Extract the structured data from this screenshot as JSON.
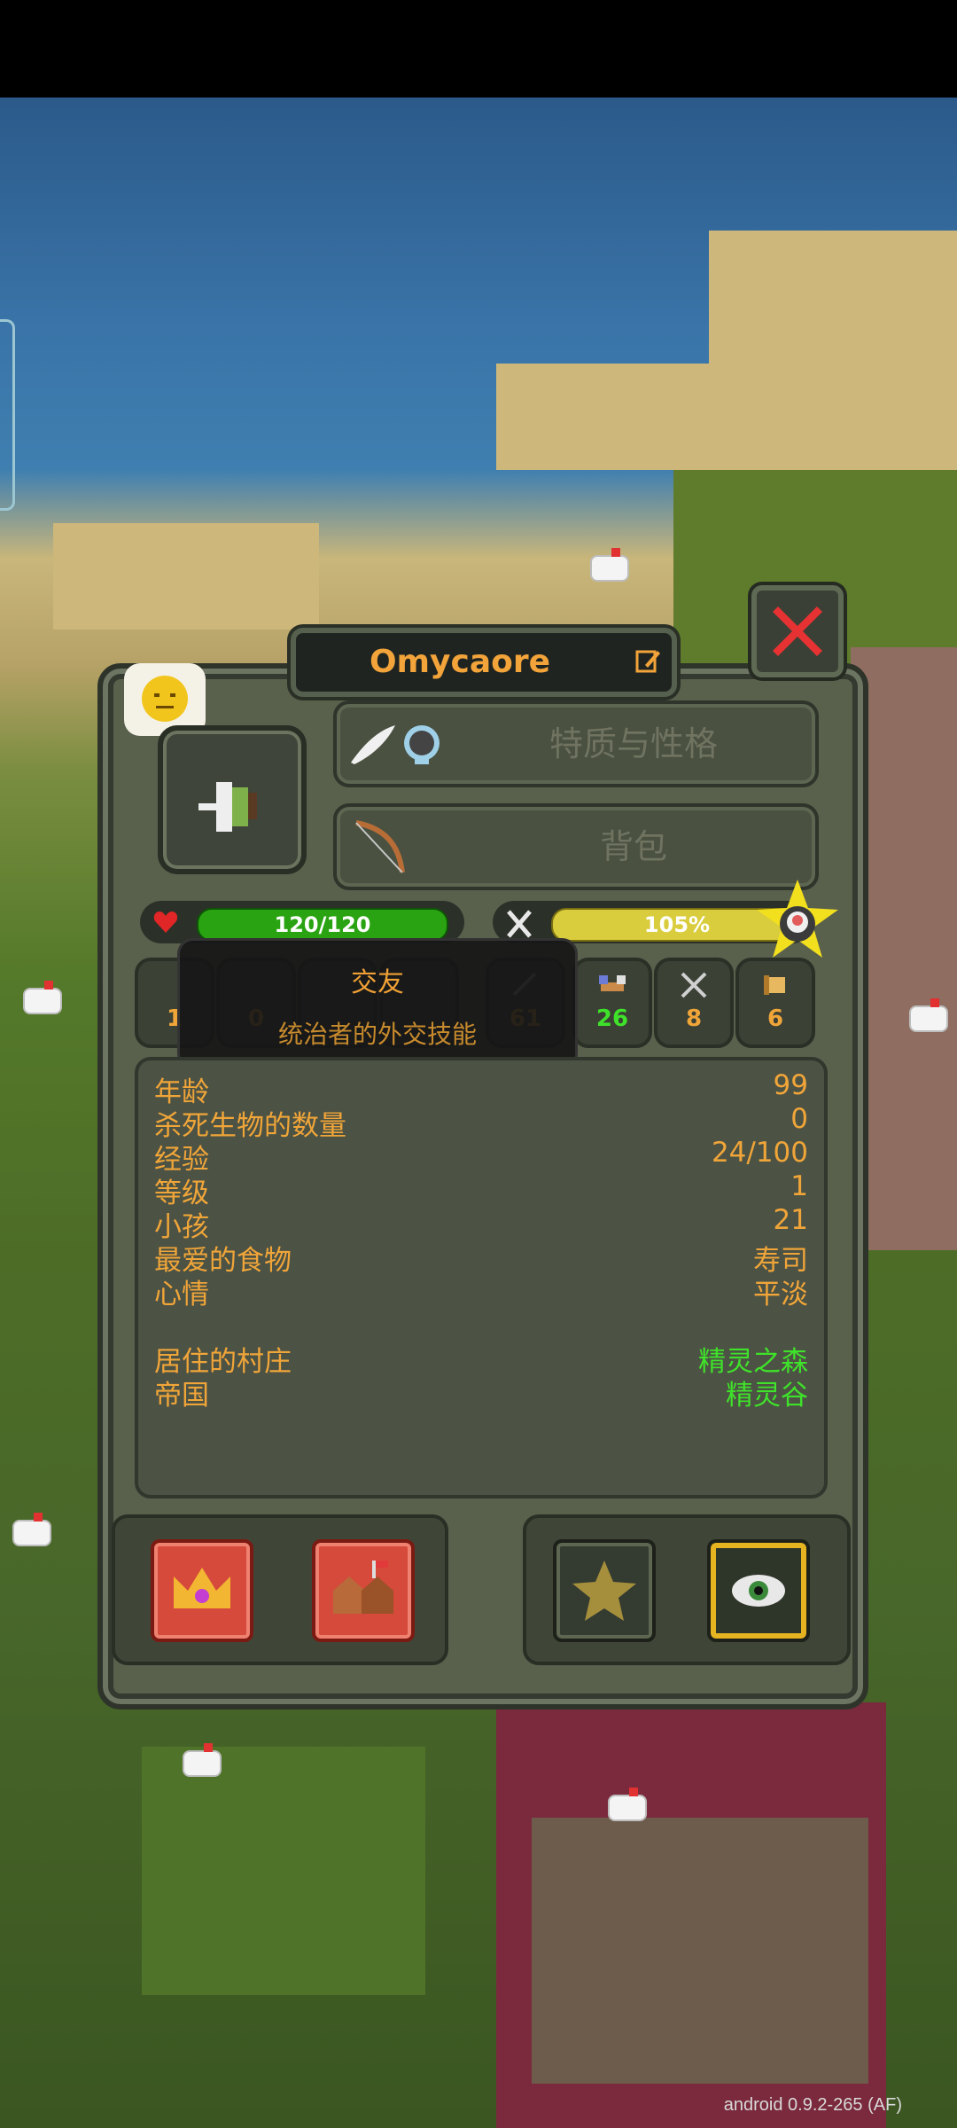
{
  "character": {
    "name": "Omycaore",
    "traits_label": "特质与性格",
    "inventory_label": "背包",
    "health_text": "120/120",
    "health_fraction": 1.0,
    "hunger_text": "105%",
    "hunger_fraction": 1.0
  },
  "stats_row": {
    "items": [
      {
        "icon": "axe-icon",
        "value": "1"
      },
      {
        "icon": "shield-icon",
        "value": "0"
      },
      {
        "icon": "coin-icon",
        "value": ""
      },
      {
        "icon": "boot-icon",
        "value": ""
      },
      {
        "icon": "arrow-icon",
        "value": "61"
      },
      {
        "icon": "handshake-icon",
        "value": "26"
      },
      {
        "icon": "swords-icon",
        "value": "8"
      },
      {
        "icon": "scroll-icon",
        "value": "6"
      }
    ]
  },
  "tooltip": {
    "title": "交友",
    "description": "统治者的外交技能"
  },
  "info": {
    "age_label": "年龄",
    "age": "99",
    "kills_label": "杀死生物的数量",
    "kills": "0",
    "exp_label": "经验",
    "exp": "24/100",
    "level_label": "等级",
    "level": "1",
    "children_label": "小孩",
    "children": "21",
    "food_label": "最爱的食物",
    "food": "寿司",
    "mood_label": "心情",
    "mood": "平淡",
    "village_label": "居住的村庄",
    "village": "精灵之森",
    "kingdom_label": "帝国",
    "kingdom": "精灵谷"
  },
  "version": "android 0.9.2-265 (AF)",
  "colors": {
    "accent": "#f0a539",
    "green_value": "#3fe22a",
    "health": "#2aa312",
    "hunger": "#d9cd3d",
    "close": "#e63232"
  }
}
